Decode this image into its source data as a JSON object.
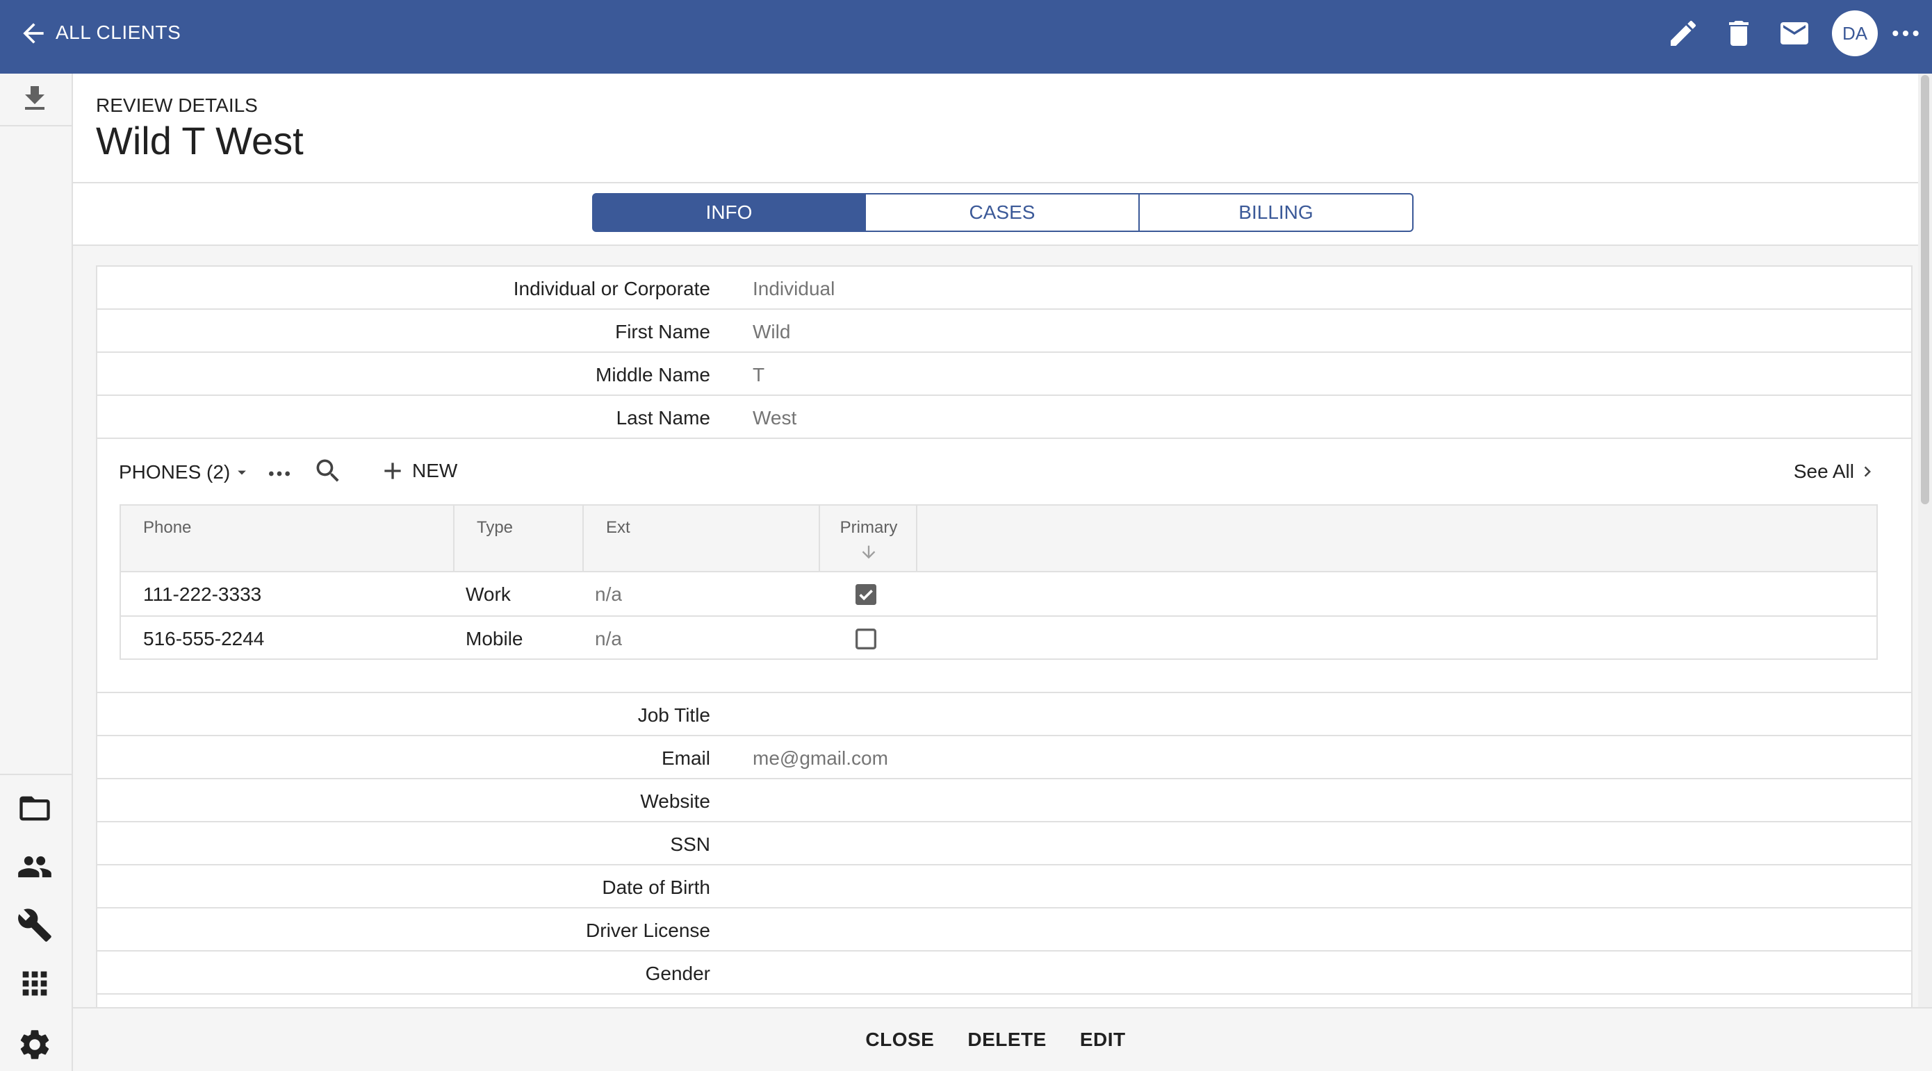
{
  "colors": {
    "primary": "#3b5998",
    "rail_bg": "#f5f5f5",
    "border": "#e0e0e0"
  },
  "topbar": {
    "back_label": "ALL CLIENTS",
    "icons": [
      "arrow-back-icon",
      "pencil-icon",
      "trash-icon",
      "mail-icon",
      "more-icon"
    ],
    "avatar": "DA"
  },
  "rail": {
    "icons": [
      "download-icon",
      "folder-icon",
      "people-icon",
      "wrench-icon",
      "apps-grid-icon",
      "gear-icon"
    ]
  },
  "header": {
    "subtitle": "REVIEW DETAILS",
    "title": "Wild T West"
  },
  "tabs": [
    {
      "label": "INFO",
      "active": true
    },
    {
      "label": "CASES",
      "active": false
    },
    {
      "label": "BILLING",
      "active": false
    }
  ],
  "fields_top": [
    {
      "label": "Individual or Corporate",
      "value": "Individual"
    },
    {
      "label": "First Name",
      "value": "Wild"
    },
    {
      "label": "Middle Name",
      "value": "T"
    },
    {
      "label": "Last Name",
      "value": "West"
    }
  ],
  "phones": {
    "title": "PHONES (2)",
    "new_label": "NEW",
    "see_all": "See All",
    "columns": [
      "Phone",
      "Type",
      "Ext",
      "Primary"
    ],
    "rows": [
      {
        "phone": "111-222-3333",
        "type": "Work",
        "ext": "n/a",
        "primary": true
      },
      {
        "phone": "516-555-2244",
        "type": "Mobile",
        "ext": "n/a",
        "primary": false
      }
    ]
  },
  "fields_bottom": [
    {
      "label": "Job Title",
      "value": ""
    },
    {
      "label": "Email",
      "value": "me@gmail.com"
    },
    {
      "label": "Website",
      "value": ""
    },
    {
      "label": "SSN",
      "value": ""
    },
    {
      "label": "Date of Birth",
      "value": ""
    },
    {
      "label": "Driver License",
      "value": ""
    },
    {
      "label": "Gender",
      "value": ""
    }
  ],
  "actions": {
    "close": "CLOSE",
    "delete": "DELETE",
    "edit": "EDIT"
  }
}
